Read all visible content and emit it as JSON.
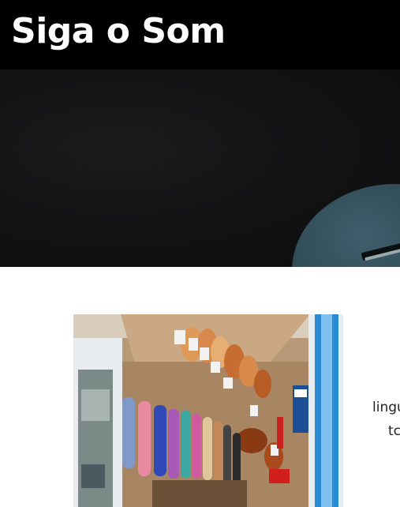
{
  "header": {
    "title": "Siga o Som"
  },
  "hero": {
    "image": "dark-guitar-hero-image"
  },
  "content": {
    "image": "music-store-guitars-photo",
    "text_line_1": "lingu",
    "text_line_2": "tc"
  }
}
